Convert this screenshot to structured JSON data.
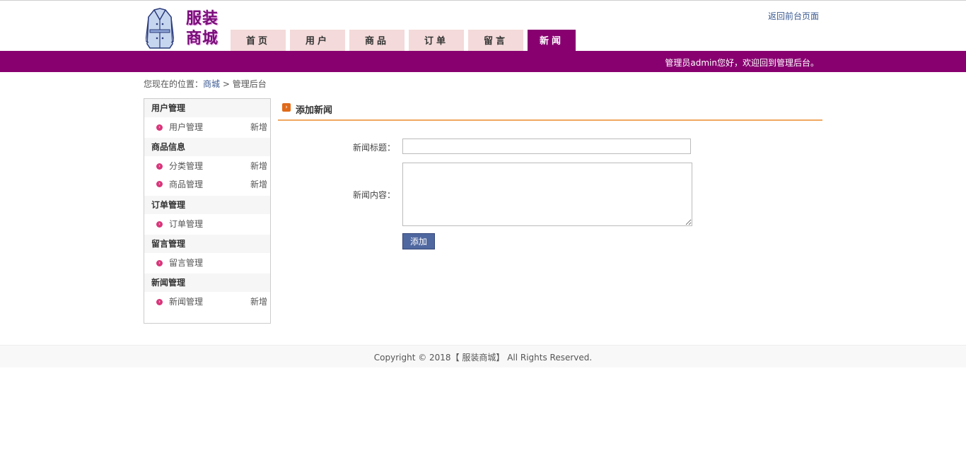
{
  "site": {
    "logo_text": "服装\n商城",
    "return_link": "返回前台页面"
  },
  "nav": {
    "tabs": [
      {
        "label": "首页",
        "active": false
      },
      {
        "label": "用户",
        "active": false
      },
      {
        "label": "商品",
        "active": false
      },
      {
        "label": "订单",
        "active": false
      },
      {
        "label": "留言",
        "active": false
      },
      {
        "label": "新闻",
        "active": true
      }
    ]
  },
  "banner": {
    "welcome": "管理员admin您好，欢迎回到管理后台。"
  },
  "breadcrumb": {
    "prefix": "您现在的位置：",
    "home": "商城",
    "sep": ">",
    "current": "管理后台"
  },
  "sidebar": {
    "sections": [
      {
        "title": "用户管理",
        "items": [
          {
            "label": "用户管理",
            "add": "新增"
          }
        ]
      },
      {
        "title": "商品信息",
        "items": [
          {
            "label": "分类管理",
            "add": "新增"
          },
          {
            "label": "商品管理",
            "add": "新增"
          }
        ]
      },
      {
        "title": "订单管理",
        "items": [
          {
            "label": "订单管理",
            "add": ""
          }
        ]
      },
      {
        "title": "留言管理",
        "items": [
          {
            "label": "留言管理",
            "add": ""
          }
        ]
      },
      {
        "title": "新闻管理",
        "items": [
          {
            "label": "新闻管理",
            "add": "新增"
          }
        ]
      }
    ]
  },
  "form": {
    "heading": "添加新闻",
    "title_label": "新闻标题：",
    "title_value": "",
    "content_label": "新闻内容：",
    "content_value": "",
    "submit_label": "添加"
  },
  "footer": {
    "copyright": "Copyright © 2018【 服装商城】 All Rights Reserved."
  },
  "colors": {
    "brand": "#880070",
    "tab_bg": "#f4dada",
    "accent_line": "#f0a860",
    "button": "#5068a0"
  }
}
